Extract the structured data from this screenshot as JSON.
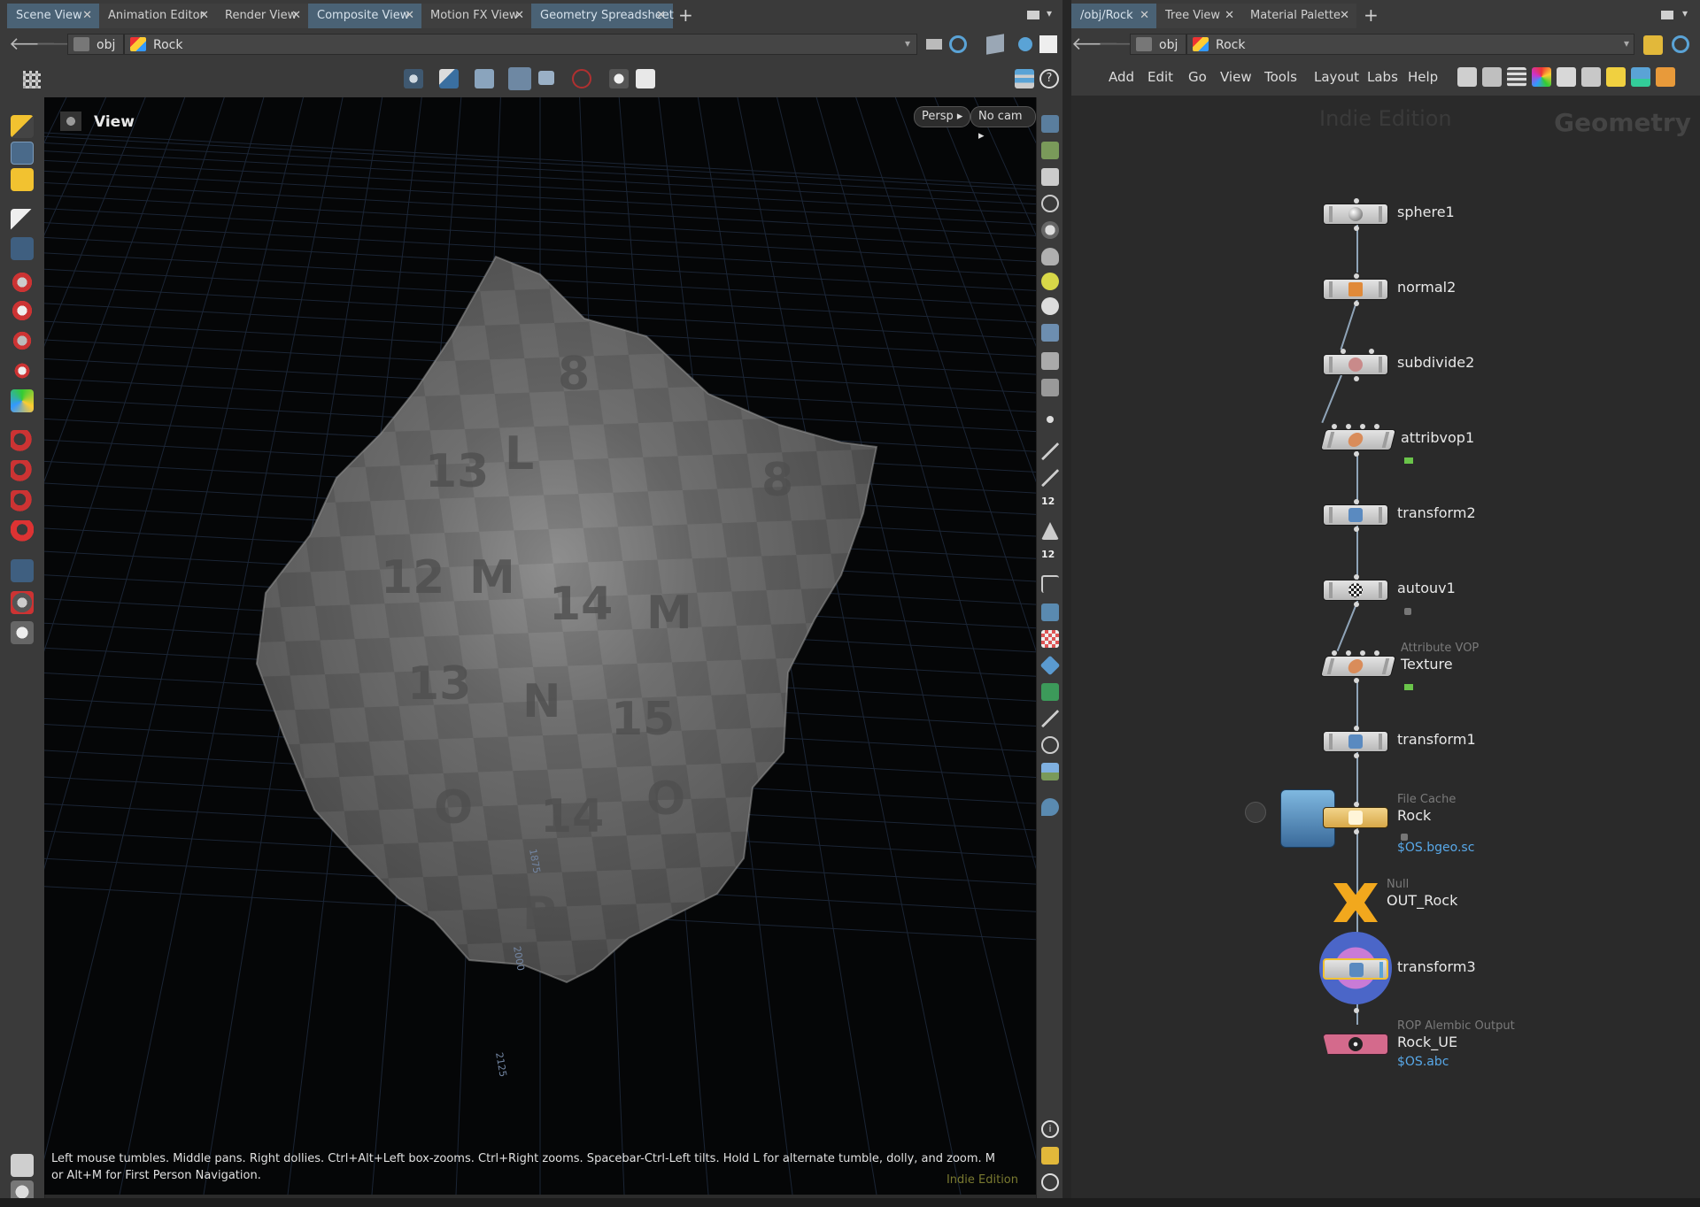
{
  "left_tabs": [
    {
      "label": "Scene View",
      "active": true
    },
    {
      "label": "Animation Editor",
      "active": false
    },
    {
      "label": "Render View",
      "active": false
    },
    {
      "label": "Composite View",
      "active": true
    },
    {
      "label": "Motion FX View",
      "active": false
    },
    {
      "label": "Geometry Spreadsheet",
      "active": true
    }
  ],
  "right_tabs": [
    {
      "label": "/obj/Rock",
      "active": true
    },
    {
      "label": "Tree View",
      "active": false
    },
    {
      "label": "Material Palette",
      "active": false
    }
  ],
  "left_path": {
    "root": "obj",
    "node": "Rock"
  },
  "right_path": {
    "root": "obj",
    "node": "Rock"
  },
  "viewport": {
    "label": "View",
    "persp_button": "Persp ▸",
    "cam_button": "No cam ▸",
    "status_text": "Left mouse tumbles. Middle pans. Right dollies. Ctrl+Alt+Left box-zooms. Ctrl+Right zooms. Spacebar-Ctrl-Left tilts. Hold L for alternate tumble, dolly, and zoom. M or Alt+M for First Person Navigation.",
    "edition": "Indie Edition",
    "grid_labels": [
      "1875",
      "2000",
      "2125"
    ]
  },
  "network_menu": [
    "Add",
    "Edit",
    "Go",
    "View",
    "Tools",
    "Layout",
    "Labs",
    "Help"
  ],
  "network": {
    "watermark_edition": "Indie Edition",
    "context_label": "Geometry",
    "nodes": [
      {
        "name": "sphere1",
        "type": "",
        "extra": "",
        "icon": "sphere-icon",
        "color": "#cfcfcf"
      },
      {
        "name": "normal2",
        "type": "",
        "extra": "",
        "icon": "normal-icon",
        "color": "#cfcfcf"
      },
      {
        "name": "subdivide2",
        "type": "",
        "extra": "",
        "icon": "subdivide-icon",
        "color": "#cfcfcf"
      },
      {
        "name": "attribvop1",
        "type": "",
        "extra": "",
        "icon": "vop-icon",
        "color": "#cfcfcf"
      },
      {
        "name": "transform2",
        "type": "",
        "extra": "",
        "icon": "transform-icon",
        "color": "#cfcfcf"
      },
      {
        "name": "autouv1",
        "type": "",
        "extra": "",
        "icon": "checker-icon",
        "color": "#cfcfcf"
      },
      {
        "name": "Texture",
        "type": "Attribute VOP",
        "extra": "",
        "icon": "vop-icon",
        "color": "#cfcfcf"
      },
      {
        "name": "transform1",
        "type": "",
        "extra": "",
        "icon": "transform-icon",
        "color": "#cfcfcf"
      },
      {
        "name": "Rock",
        "type": "File Cache",
        "extra": "$OS.bgeo.sc",
        "icon": "filecache-icon",
        "color": "#e8c26a"
      },
      {
        "name": "OUT_Rock",
        "type": "Null",
        "extra": "",
        "icon": "null-icon",
        "color": "#f2a81d"
      },
      {
        "name": "transform3",
        "type": "",
        "extra": "",
        "icon": "transform-icon",
        "color": "#cfcfcf"
      },
      {
        "name": "Rock_UE",
        "type": "ROP Alembic Output",
        "extra": "$OS.abc",
        "icon": "alembic-icon",
        "color": "#d46a8c"
      }
    ]
  },
  "colors": {
    "accent_tab": "#4a6275",
    "wire": "#8fa4b8",
    "link_text": "#58a8e8"
  }
}
